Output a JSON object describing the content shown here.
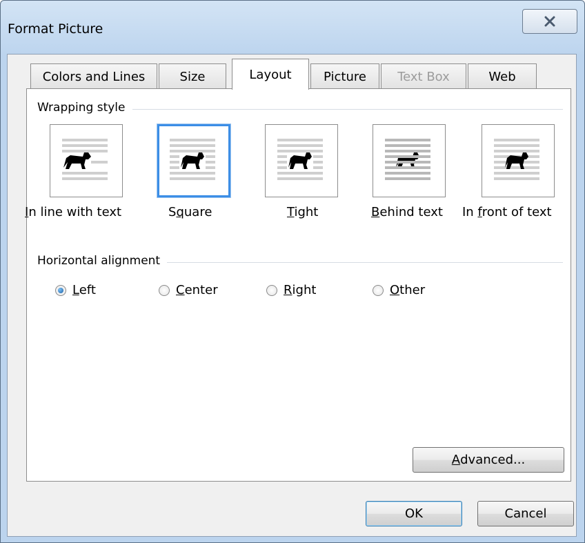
{
  "window": {
    "title": "Format Picture"
  },
  "tabs": [
    {
      "label": "Colors and Lines",
      "state": "normal"
    },
    {
      "label": "Size",
      "state": "normal"
    },
    {
      "label": "Layout",
      "state": "active"
    },
    {
      "label": "Picture",
      "state": "normal"
    },
    {
      "label": "Text Box",
      "state": "disabled"
    },
    {
      "label": "Web",
      "state": "normal"
    }
  ],
  "wrapping": {
    "group_label": "Wrapping style",
    "options": [
      {
        "pre": "",
        "key": "I",
        "post": "n line with text",
        "selected": false
      },
      {
        "pre": "S",
        "key": "q",
        "post": "uare",
        "selected": true
      },
      {
        "pre": "",
        "key": "T",
        "post": "ight",
        "selected": false
      },
      {
        "pre": "",
        "key": "B",
        "post": "ehind text",
        "selected": false
      },
      {
        "pre": "In ",
        "key": "f",
        "post": "ront of text",
        "selected": false
      }
    ]
  },
  "alignment": {
    "group_label": "Horizontal alignment",
    "options": [
      {
        "key": "L",
        "post": "eft",
        "checked": true
      },
      {
        "key": "C",
        "post": "enter",
        "checked": false
      },
      {
        "key": "R",
        "post": "ight",
        "checked": false
      },
      {
        "key": "O",
        "post": "ther",
        "checked": false
      }
    ]
  },
  "advanced": {
    "key": "A",
    "post": "dvanced..."
  },
  "buttons": {
    "ok": "OK",
    "cancel": "Cancel"
  },
  "colors": {
    "selection_blue": "#3c8ee6",
    "title_bar": "#bcd4ee",
    "disabled_text": "#9c9c9c"
  }
}
